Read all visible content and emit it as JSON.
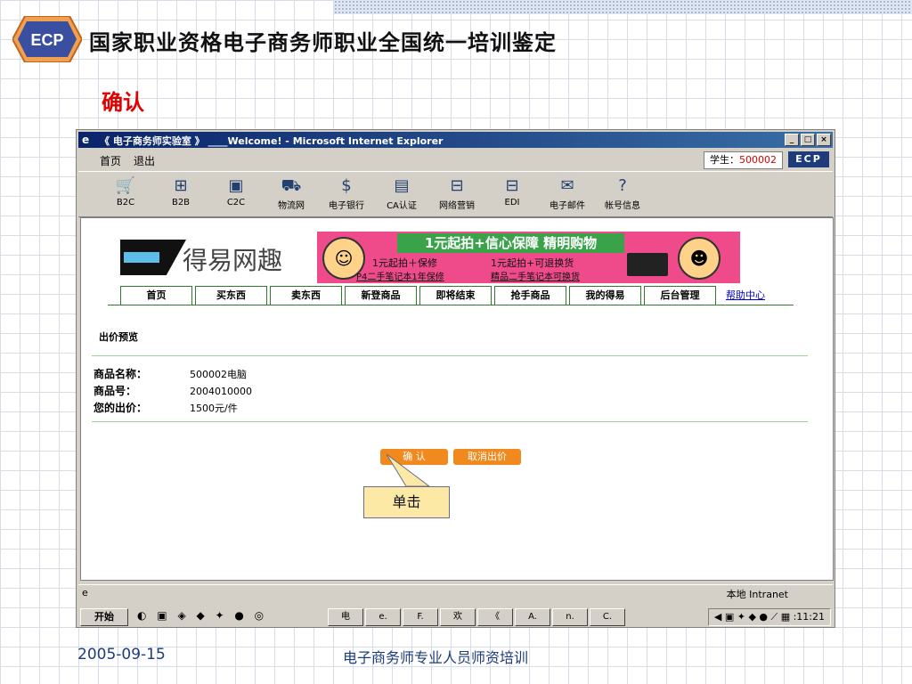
{
  "slide": {
    "title": "国家职业资格电子商务师职业全国统一培训鉴定",
    "heading": "确认",
    "logo_text": "ECP",
    "footer_date": "2005-09-15",
    "footer_org": "电子商务师专业人员师资培训"
  },
  "browser": {
    "title": "《 电子商务师实验室 》 ____Welcome! - Microsoft Internet Explorer",
    "window_buttons": [
      "_",
      "□",
      "×"
    ],
    "menu": [
      "首页",
      "退出"
    ],
    "student_label": "学生：",
    "student_id": "500002",
    "badge": "ECP",
    "toolbar": [
      "B2C",
      "B2B",
      "C2C",
      "物流网",
      "电子银行",
      "CA认证",
      "网络营销",
      "EDI",
      "电子邮件",
      "帐号信息"
    ],
    "status_zone": "本地 Intranet"
  },
  "site": {
    "logo_name": "得易网趣",
    "banner_title": "1元起拍+信心保障 精明购物",
    "banner_line1": "1元起拍＋保修",
    "banner_line2": "1元起拍+可退换货",
    "banner_sub1": "P4二手笔记本1年保修",
    "banner_sub2": "精品二手笔记本可换货",
    "nav": [
      "首页",
      "买东西",
      "卖东西",
      "新登商品",
      "即将结束",
      "抢手商品",
      "我的得易",
      "后台管理"
    ],
    "help": "帮助中心"
  },
  "bid_preview": {
    "title": "出价预览",
    "rows": [
      {
        "label": "商品名称：",
        "value": "500002电脑"
      },
      {
        "label": "商品号：",
        "value": "2004010000"
      },
      {
        "label": "您的出价：",
        "value": "1500元/件"
      }
    ],
    "confirm_button": "确 认",
    "cancel_button": "取消出价"
  },
  "callout": "单击",
  "taskbar": {
    "start": "开始",
    "quicklaunch": "◐ ▣ ◈ ◆ ✦ ● ◎",
    "tasks": [
      "电",
      "e.",
      "F.",
      "欢",
      "《",
      "A.",
      "n.",
      "C."
    ],
    "clock": ":11:21"
  }
}
